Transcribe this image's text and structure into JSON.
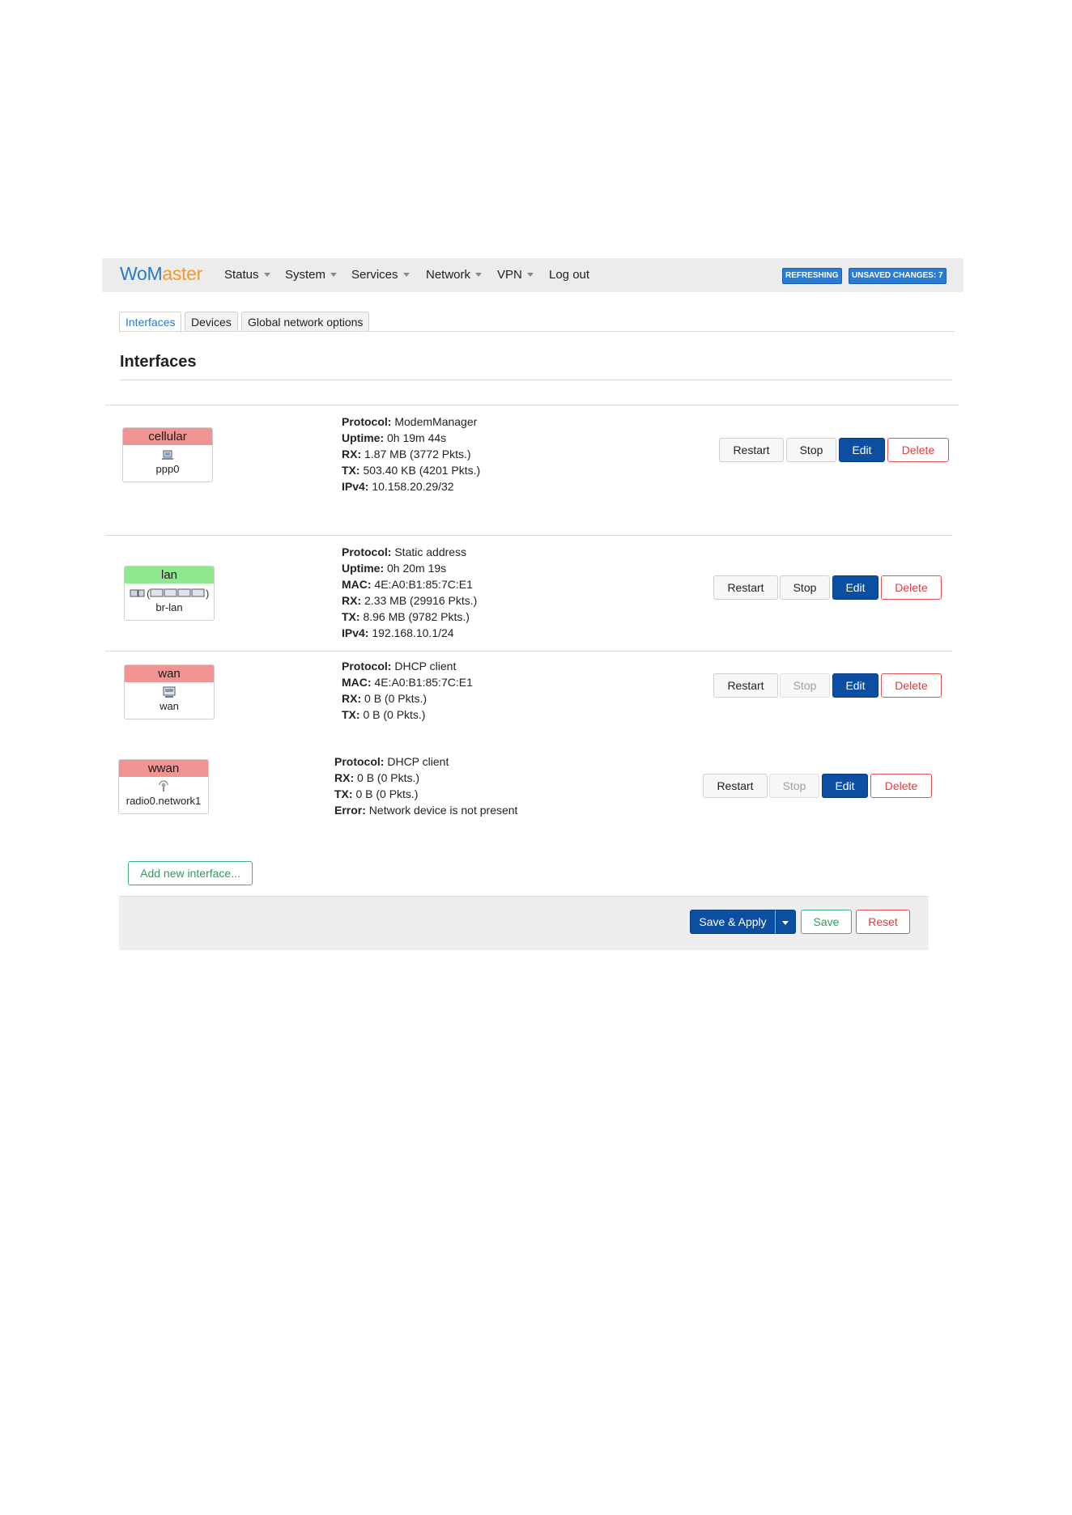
{
  "brand": {
    "wo": "WoM",
    "ma": "aster"
  },
  "nav": {
    "items": [
      "Status",
      "System",
      "Services",
      "Network",
      "VPN",
      "Log out"
    ]
  },
  "badges": {
    "refreshing": "REFRESHING",
    "unsaved": "UNSAVED CHANGES: 7"
  },
  "tabs": [
    "Interfaces",
    "Devices",
    "Global network options"
  ],
  "page_title": "Interfaces",
  "buttons": {
    "restart": "Restart",
    "stop": "Stop",
    "edit": "Edit",
    "delete": "Delete"
  },
  "interfaces": [
    {
      "name": "cellular",
      "device": "ppp0",
      "header_color": "#f09393",
      "info": [
        {
          "label": "Protocol:",
          "value": " ModemManager"
        },
        {
          "label": "Uptime:",
          "value": " 0h 19m 44s"
        },
        {
          "label": "RX:",
          "value": " 1.87 MB (3772 Pkts.)"
        },
        {
          "label": "TX:",
          "value": " 503.40 KB (4201 Pkts.)"
        },
        {
          "label": "IPv4:",
          "value": " 10.158.20.29/32"
        }
      ],
      "stop_enabled": true
    },
    {
      "name": "lan",
      "device": "br-lan",
      "header_color": "#8fe88f",
      "info": [
        {
          "label": "Protocol:",
          "value": " Static address"
        },
        {
          "label": "Uptime:",
          "value": " 0h 20m 19s"
        },
        {
          "label": "MAC:",
          "value": " 4E:A0:B1:85:7C:E1"
        },
        {
          "label": "RX:",
          "value": " 2.33 MB (29916 Pkts.)"
        },
        {
          "label": "TX:",
          "value": " 8.96 MB (9782 Pkts.)"
        },
        {
          "label": "IPv4:",
          "value": " 192.168.10.1/24"
        }
      ],
      "stop_enabled": true
    },
    {
      "name": "wan",
      "device": "wan",
      "header_color": "#f09393",
      "info": [
        {
          "label": "Protocol:",
          "value": " DHCP client"
        },
        {
          "label": "MAC:",
          "value": " 4E:A0:B1:85:7C:E1"
        },
        {
          "label": "RX:",
          "value": " 0 B (0 Pkts.)"
        },
        {
          "label": "TX:",
          "value": " 0 B (0 Pkts.)"
        }
      ],
      "stop_enabled": false
    },
    {
      "name": "wwan",
      "device": "radio0.network1",
      "header_color": "#f09393",
      "info": [
        {
          "label": "Protocol:",
          "value": " DHCP client"
        },
        {
          "label": "RX:",
          "value": " 0 B (0 Pkts.)"
        },
        {
          "label": "TX:",
          "value": " 0 B (0 Pkts.)"
        },
        {
          "label": "Error:",
          "value": " Network device is not present"
        }
      ],
      "stop_enabled": false
    }
  ],
  "add_interface_label": "Add new interface...",
  "footer": {
    "save_apply": "Save & Apply",
    "save": "Save",
    "reset": "Reset"
  }
}
